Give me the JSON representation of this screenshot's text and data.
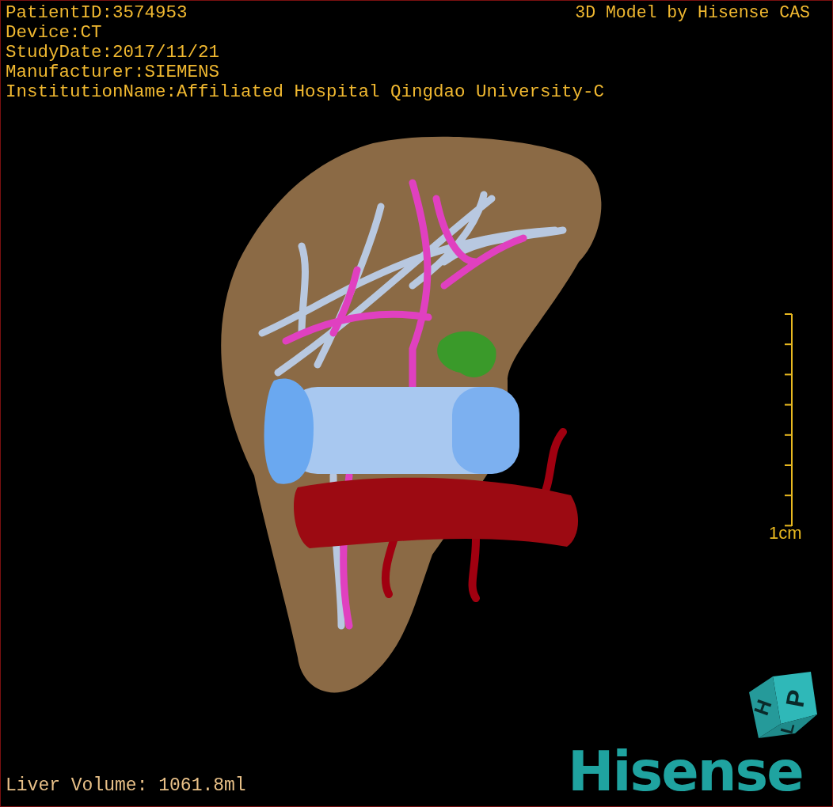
{
  "header": {
    "lines": [
      "PatientID:3574953",
      "Device:CT",
      "StudyDate:2017/11/21",
      "Manufacturer:SIEMENS",
      "InstitutionName:Affiliated Hospital Qingdao University-C"
    ]
  },
  "credit": "3D Model by Hisense CAS",
  "scale_bar": {
    "label": "1cm"
  },
  "orientation_cube": {
    "faces": [
      "H",
      "P",
      "L"
    ]
  },
  "logo": "Hisense",
  "footer": {
    "liver_volume": "Liver Volume: 1061.8ml"
  }
}
